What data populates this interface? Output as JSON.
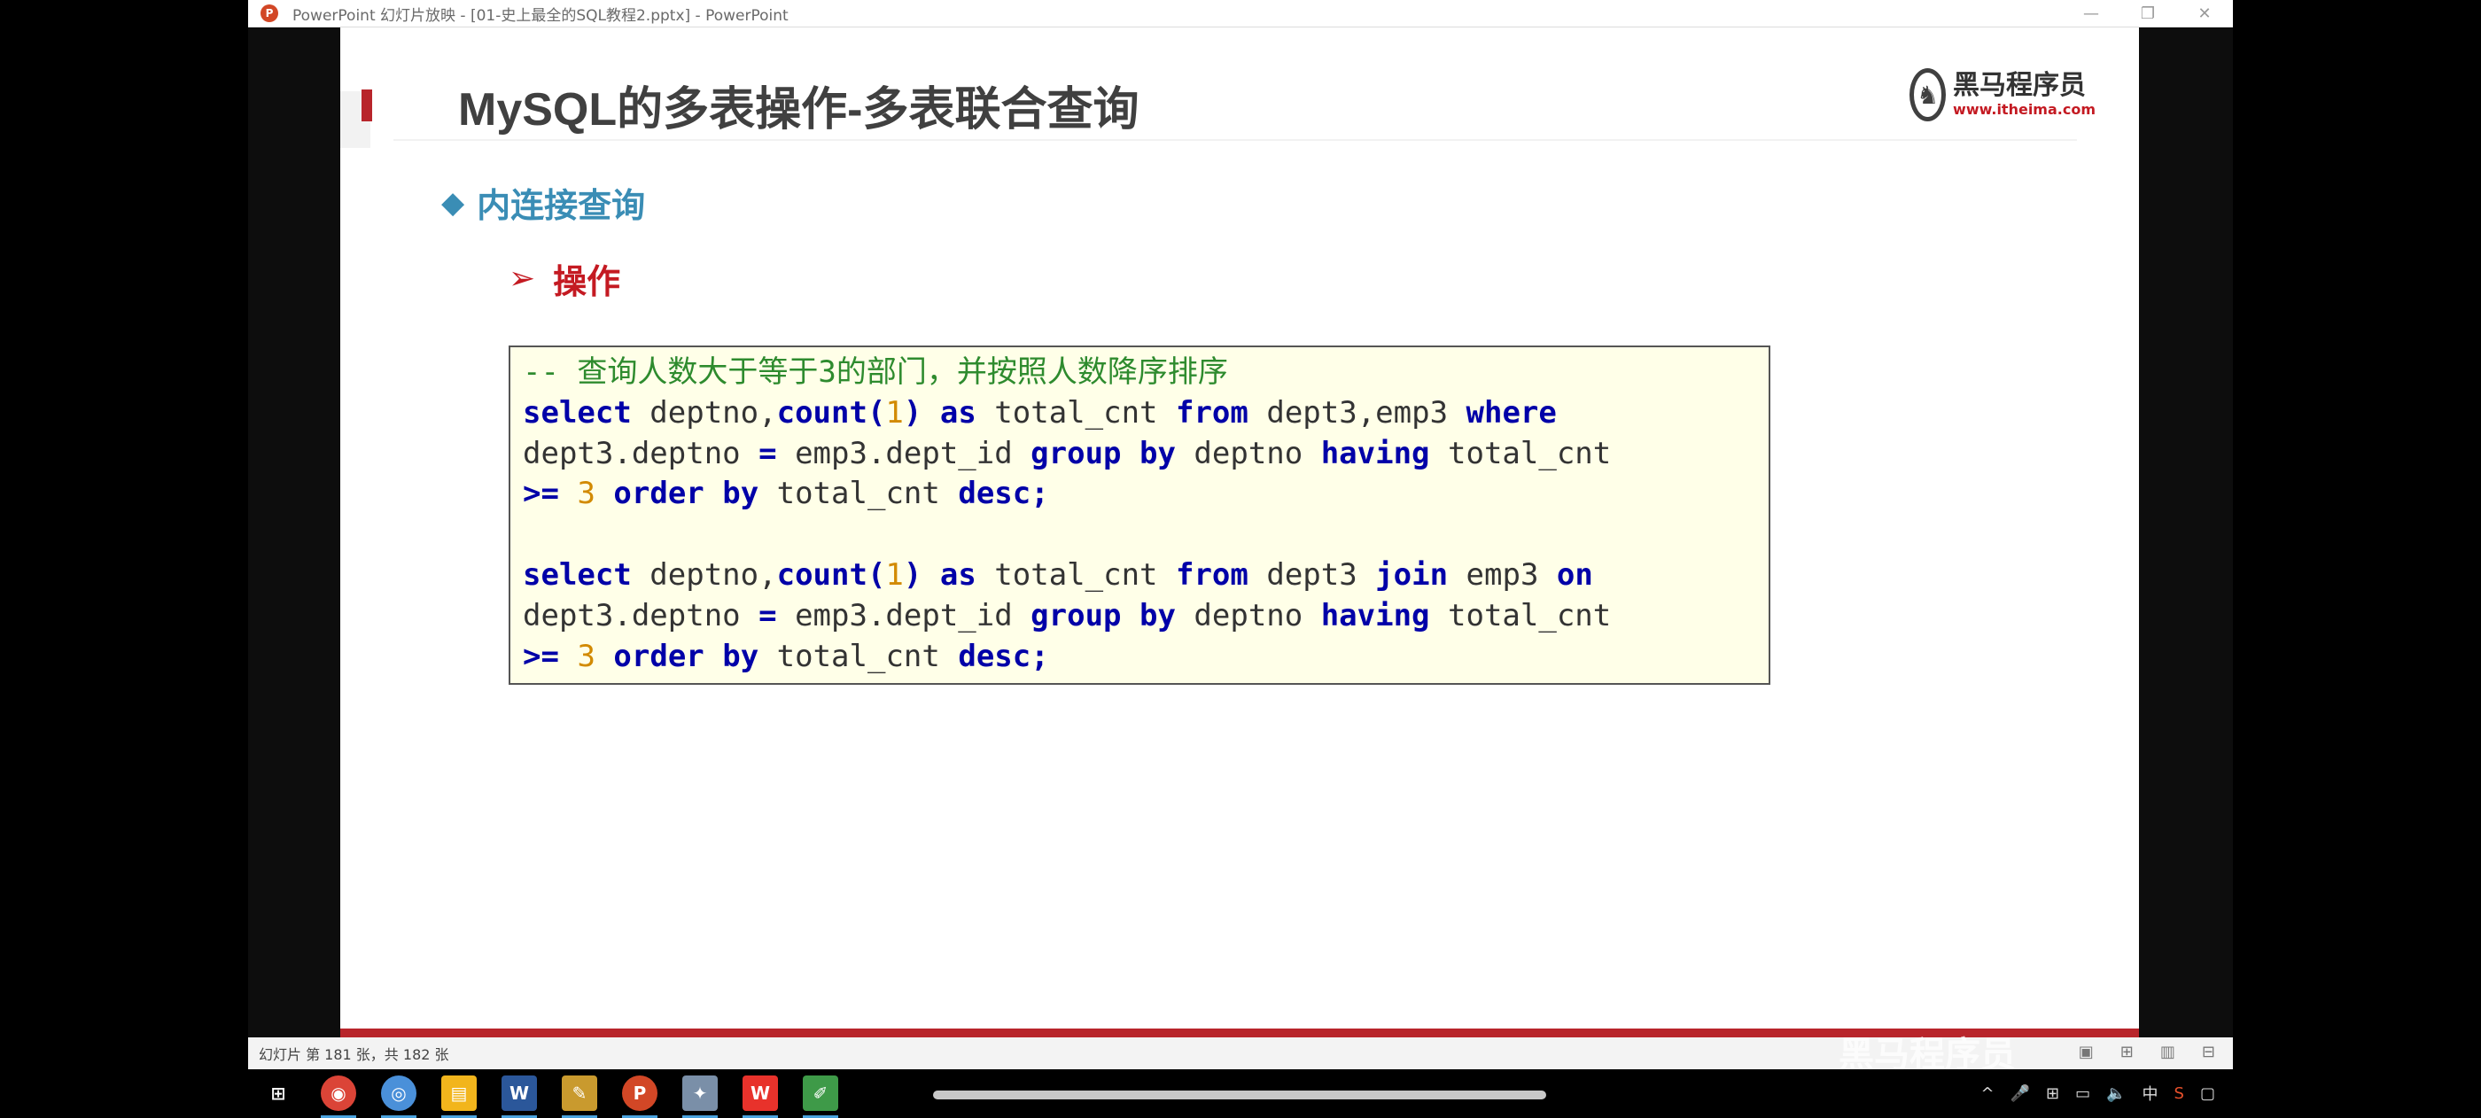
{
  "window": {
    "title": "PowerPoint 幻灯片放映 - [01-史上最全的SQL教程2.pptx] - PowerPoint",
    "app_icon": "P",
    "controls": [
      "minimize-icon",
      "restore-icon",
      "close-icon"
    ],
    "control_glyphs": [
      "—",
      "❐",
      "✕"
    ]
  },
  "slide": {
    "title": "MySQL的多表操作-多表联合查询",
    "logo": {
      "cn": "黑马程序员",
      "url": "www.itheima.com"
    },
    "bullet1": {
      "glyph": "◆",
      "text": "内连接查询"
    },
    "bullet2": {
      "glyph": "➢",
      "text": "操作"
    },
    "code": {
      "comment": "-- 查询人数大于等于3的部门，并按照人数降序排序",
      "q1_line1": [
        "select",
        " deptno,",
        "count(",
        "1",
        ")",
        " as",
        " total_cnt ",
        "from",
        " dept3,emp3 ",
        "where"
      ],
      "q1_line2": [
        "dept3.deptno ",
        "=",
        " emp3.dept_id ",
        "group by",
        " deptno ",
        "having",
        " total_cnt"
      ],
      "q1_line3": [
        ">=",
        " ",
        "3",
        " ",
        "order by",
        " total_cnt ",
        "desc;"
      ],
      "q2_line1": [
        "select",
        " deptno,",
        "count(",
        "1",
        ")",
        " as",
        " total_cnt ",
        "from",
        " dept3 ",
        "join",
        " emp3 ",
        "on"
      ],
      "q2_line2": [
        "dept3.deptno ",
        "=",
        " emp3.dept_id ",
        "group by",
        " deptno ",
        "having",
        " total_cnt"
      ],
      "q2_line3": [
        ">=",
        " ",
        "3",
        " ",
        "order by",
        " total_cnt ",
        "desc;"
      ]
    },
    "colors": {
      "accent_red": "#b8252b",
      "bullet_blue": "#3a8db5",
      "keyword": "#0000a8",
      "comment": "#2e8b2e",
      "number": "#d28a00",
      "code_bg": "#ffffe8"
    }
  },
  "statusbar": {
    "slide_info": "幻灯片 第 181 张，共 182 张",
    "watermark": "黑马程序员"
  },
  "taskbar": {
    "icons": [
      "windows-start-icon",
      "chrome-icon",
      "browser-icon",
      "file-explorer-icon",
      "word-icon",
      "paint-icon",
      "powerpoint-icon",
      "tool-icon",
      "wps-icon",
      "editor-icon"
    ],
    "glyphs": [
      "⊞",
      "◉",
      "◎",
      "▤",
      "W",
      "✎",
      "P",
      "✦",
      "W",
      "✐"
    ],
    "tray_glyphs": [
      "^",
      "🎤",
      "⊞",
      "▭",
      "🔈",
      "中",
      "S",
      "▢"
    ]
  }
}
